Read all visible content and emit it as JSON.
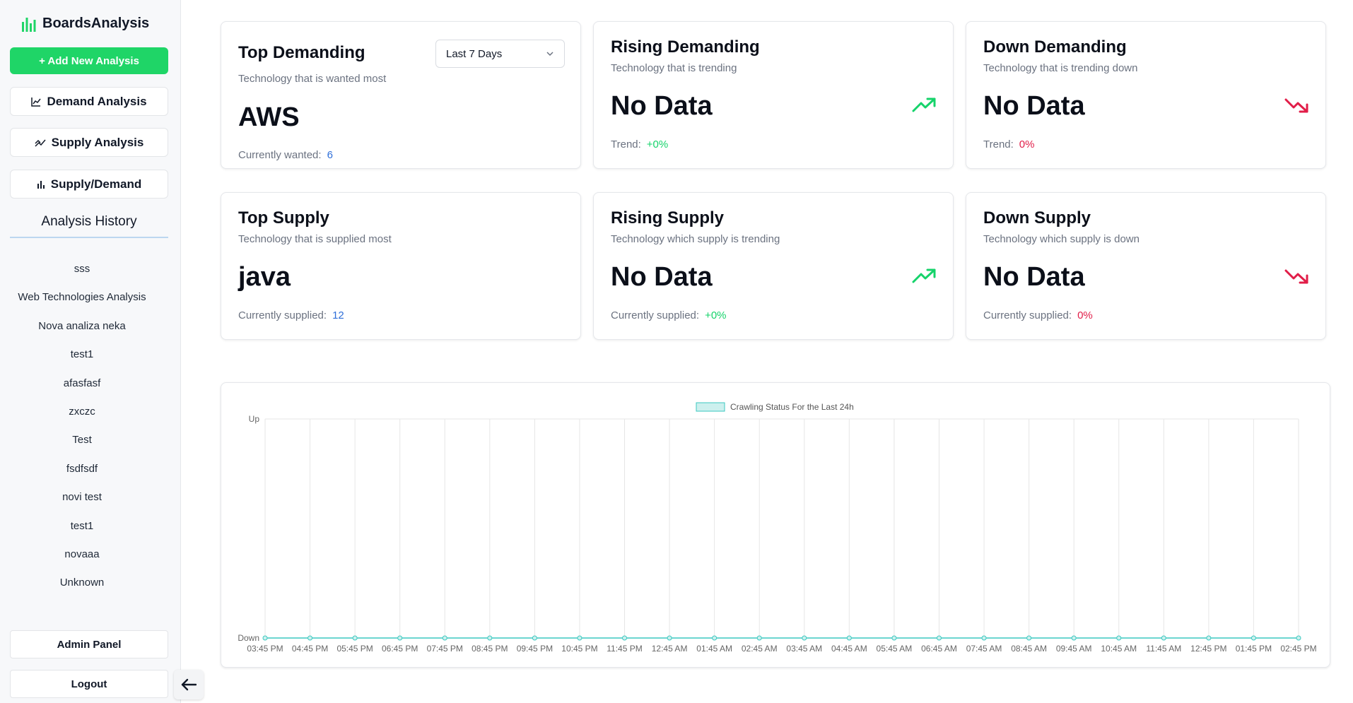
{
  "sidebar": {
    "brand": "BoardsAnalysis",
    "add_button": "+ Add New Analysis",
    "nav": [
      {
        "label": "Demand Analysis",
        "icon": "line-chart-icon"
      },
      {
        "label": "Supply Analysis",
        "icon": "trending-icon"
      },
      {
        "label": "Supply/Demand",
        "icon": "bar-chart-icon"
      }
    ],
    "history_title": "Analysis History",
    "history": [
      "sss",
      "Web Technologies Analysis",
      "Nova analiza neka",
      "test1",
      "afasfasf",
      "zxczc",
      "Test",
      "fsdfsdf",
      "novi test",
      "test1",
      "novaaa",
      "Unknown"
    ],
    "admin_label": "Admin Panel",
    "logout_label": "Logout"
  },
  "cards": [
    {
      "title": "Top Demanding",
      "subtitle": "Technology that is wanted most",
      "value": "AWS",
      "foot_label": "Currently wanted:",
      "foot_value": "6",
      "select": "Last 7 Days"
    },
    {
      "title": "Rising Demanding",
      "subtitle": "Technology that is trending",
      "value": "No Data",
      "foot_label": "Trend:",
      "foot_value": "+0%",
      "icon": "trending-up-icon"
    },
    {
      "title": "Down Demanding",
      "subtitle": "Technology that is trending down",
      "value": "No Data",
      "foot_label": "Trend:",
      "foot_value": "0%",
      "icon": "trending-down-icon"
    },
    {
      "title": "Top Supply",
      "subtitle": "Technology that is supplied most",
      "value": "java",
      "foot_label": "Currently supplied:",
      "foot_value": "12"
    },
    {
      "title": "Rising Supply",
      "subtitle": "Technology which supply is trending",
      "value": "No Data",
      "foot_label": "Currently supplied:",
      "foot_value": "+0%",
      "icon": "trending-up-icon"
    },
    {
      "title": "Down Supply",
      "subtitle": "Technology which supply is down",
      "value": "No Data",
      "foot_label": "Currently supplied:",
      "foot_value": "0%",
      "icon": "trending-down-icon"
    }
  ],
  "colors": {
    "accent": "#1fd567",
    "up": "#15d36a",
    "down": "#e11d48",
    "link": "#2f6fd9",
    "series": "#3cc9c0"
  },
  "chart_data": {
    "type": "line",
    "legend": "Crawling Status For the Last 24h",
    "legend_position": "top",
    "y_categories": [
      "Down",
      "Up"
    ],
    "x": [
      "03:45 PM",
      "04:45 PM",
      "05:45 PM",
      "06:45 PM",
      "07:45 PM",
      "08:45 PM",
      "09:45 PM",
      "10:45 PM",
      "11:45 PM",
      "12:45 AM",
      "01:45 AM",
      "02:45 AM",
      "03:45 AM",
      "04:45 AM",
      "05:45 AM",
      "06:45 AM",
      "07:45 AM",
      "08:45 AM",
      "09:45 AM",
      "10:45 AM",
      "11:45 AM",
      "12:45 PM",
      "01:45 PM",
      "02:45 PM"
    ],
    "series": [
      {
        "name": "Crawling Status For the Last 24h",
        "values": [
          "Down",
          "Down",
          "Down",
          "Down",
          "Down",
          "Down",
          "Down",
          "Down",
          "Down",
          "Down",
          "Down",
          "Down",
          "Down",
          "Down",
          "Down",
          "Down",
          "Down",
          "Down",
          "Down",
          "Down",
          "Down",
          "Down",
          "Down",
          "Down"
        ]
      }
    ],
    "grid": true
  }
}
